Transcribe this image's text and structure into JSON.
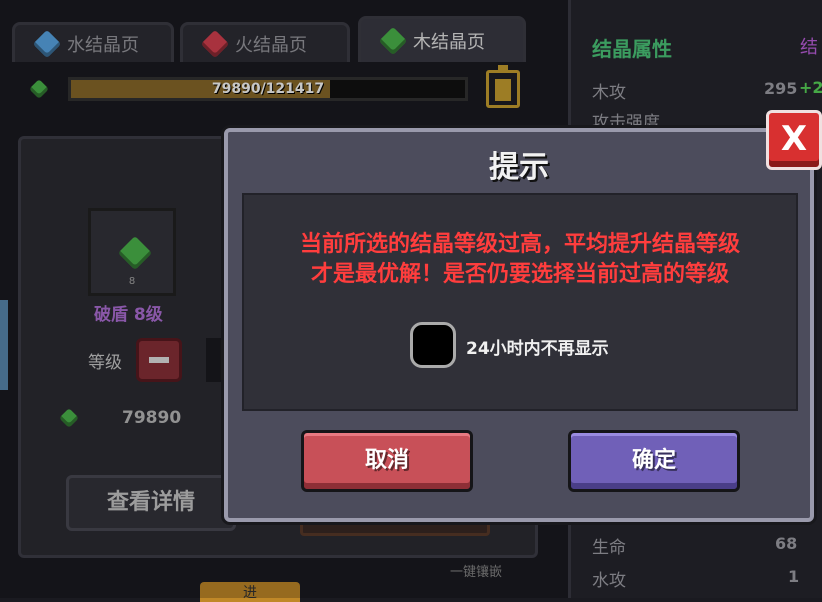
{
  "tabs": [
    {
      "label": "水结晶页",
      "icon": "blue-crystal-icon"
    },
    {
      "label": "火结晶页",
      "icon": "red-crystal-icon"
    },
    {
      "label": "木结晶页",
      "icon": "green-crystal-icon"
    }
  ],
  "xp": {
    "text": "79890/121417",
    "fraction": 0.658
  },
  "crystal": {
    "name": "破盾 8级",
    "slot_level": "8"
  },
  "level_label": "等级",
  "cost": {
    "value": "79890"
  },
  "detail_button": "查看详情",
  "onekey_label": "一键镶嵌",
  "bottom_tab": "进",
  "side_panel": {
    "title": "结晶属性",
    "title_frag": "结",
    "rows": [
      {
        "label": "木攻",
        "value": "295",
        "bonus": "+2"
      },
      {
        "label": "攻击强度",
        "value": ""
      },
      {
        "label": "生命",
        "value": "68"
      },
      {
        "label": "水攻",
        "value": "1"
      }
    ]
  },
  "dialog": {
    "title": "提示",
    "message_line1": "当前所选的结晶等级过高，平均提升结晶等级",
    "message_line2": "才是最优解！是否仍要选择当前过高的等级",
    "checkbox_label": "24小时内不再显示",
    "cancel_label": "取消",
    "confirm_label": "确定",
    "close_label": "X"
  },
  "colors": {
    "message": "#ff3d3d",
    "cancel": "#c85058",
    "confirm": "#7060b8",
    "close": "#d83030"
  }
}
